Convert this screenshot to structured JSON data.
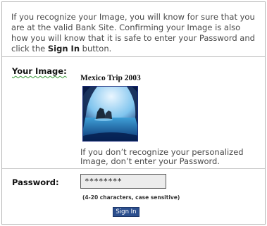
{
  "intro": {
    "text_before": "If you recognize your Image, you will know for sure that you are at the valid Bank Site.  Confirming your Image is also how you will know that it is safe to enter your Password and click the ",
    "sign_in_emphasis": "Sign In",
    "text_after": " button."
  },
  "image_section": {
    "label": "Your Image:",
    "caption": "Mexico Trip 2003",
    "warning": "If you don’t recognize your personalized Image, don’t enter your Password."
  },
  "password": {
    "label": "Password:",
    "value": "********",
    "hint": "(4-20 characters, case sensitive)"
  },
  "sign_in_button": {
    "label": "Sign In"
  },
  "colors": {
    "button_background": "#2c4f8e",
    "panel_border": "#b7b7b7",
    "input_background": "#ececec"
  }
}
